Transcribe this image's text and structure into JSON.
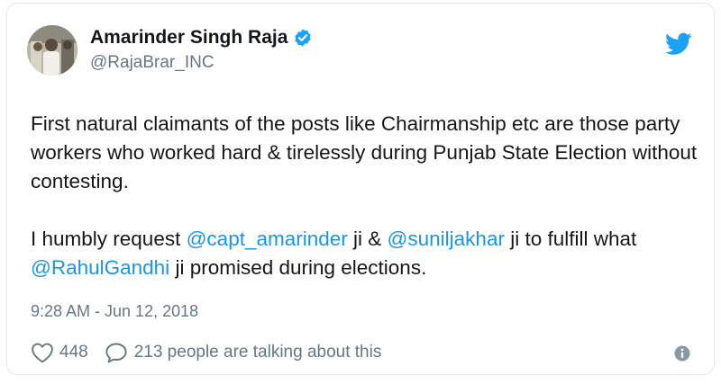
{
  "author": {
    "display_name": "Amarinder Singh Raja",
    "handle": "@RajaBrar_INC",
    "verified": true
  },
  "tweet": {
    "paragraph1": "First natural claimants of the posts like Chairmanship etc are those party workers who worked hard & tirelessly during Punjab State Election without contesting.",
    "p2_part1": "I humbly request ",
    "p2_mention1": "@capt_amarinder",
    "p2_part2": " ji & ",
    "p2_mention2": "@suniljakhar",
    "p2_part3": " ji to fulfill what ",
    "p2_mention3": "@RahulGandhi",
    "p2_part4": " ji promised during elections."
  },
  "timestamp": "9:28 AM - Jun 12, 2018",
  "actions": {
    "like_count": "448",
    "reply_text": "213 people are talking about this"
  },
  "colors": {
    "link": "#1b95e0",
    "muted": "#657786",
    "verified_badge": "#1da1f2",
    "twitter_logo": "#1da1f2"
  },
  "icons": [
    "verified-badge-icon",
    "twitter-bird-icon",
    "heart-icon",
    "speech-bubble-icon",
    "info-icon"
  ]
}
